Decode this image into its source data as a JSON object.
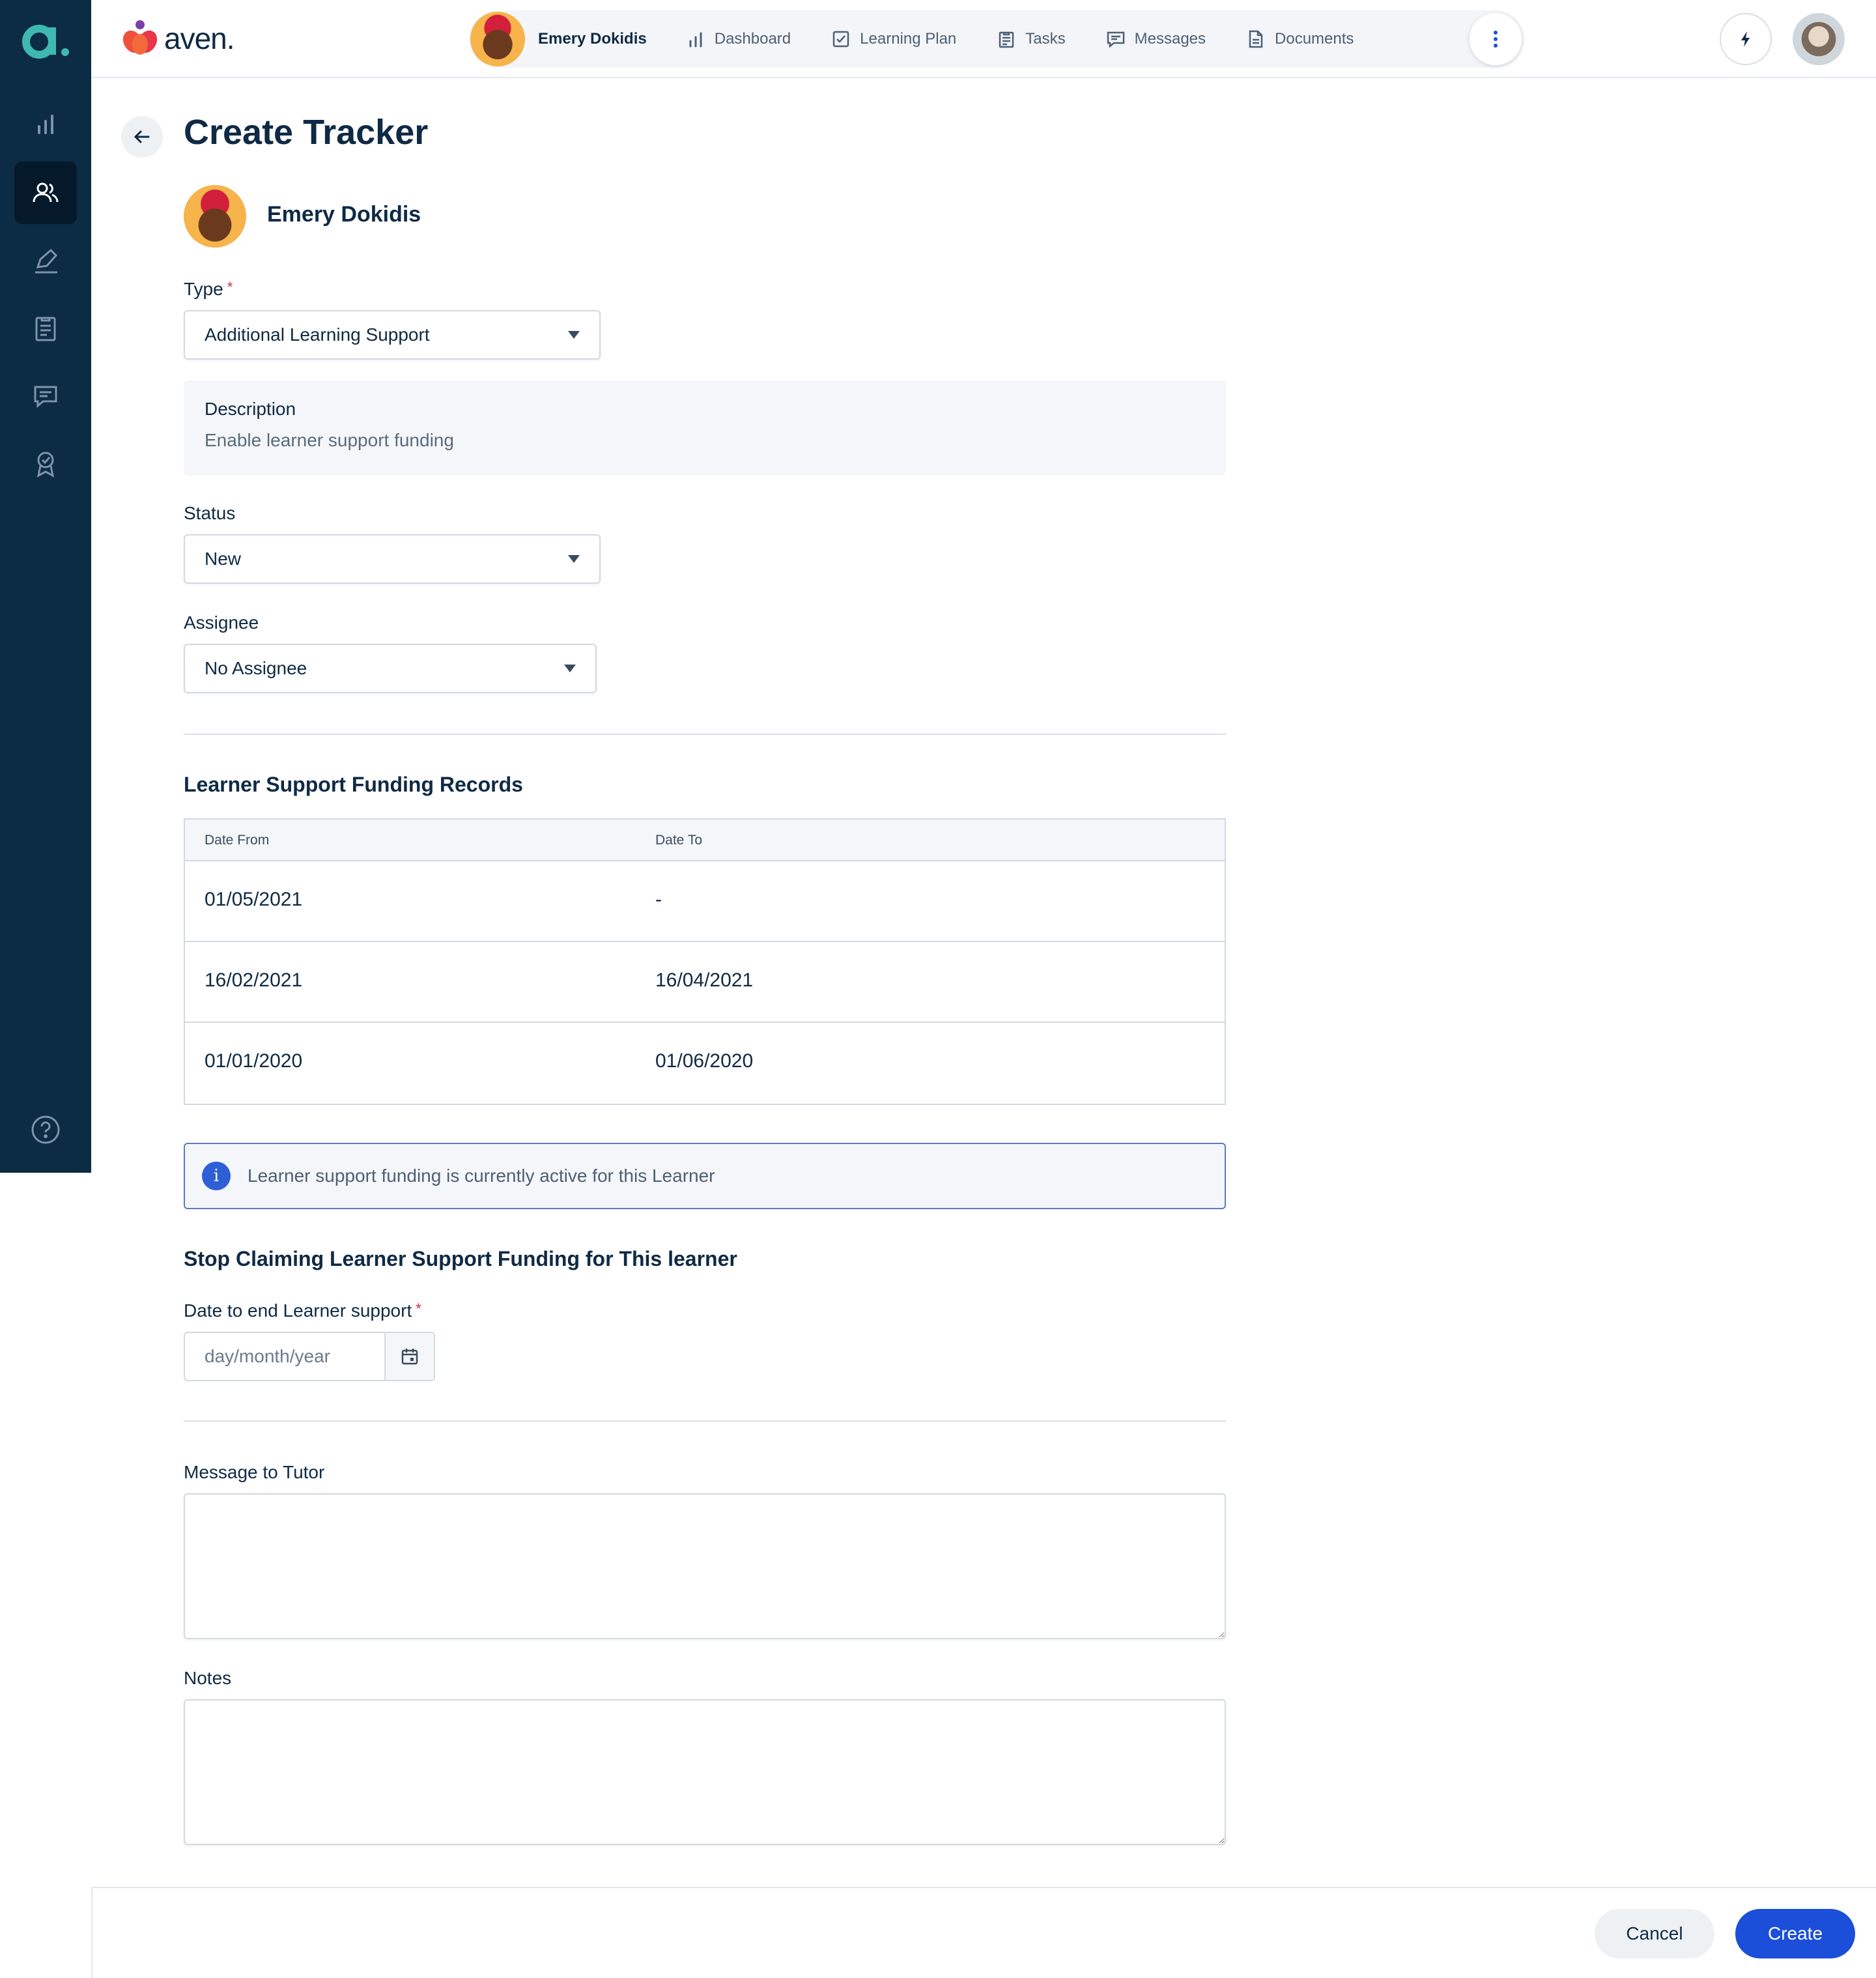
{
  "app": {
    "brand": "aven.",
    "rail_logo": "a."
  },
  "nav": {
    "learner_name": "Emery Dokidis",
    "links": [
      {
        "label": "Dashboard",
        "icon": "bar-chart-icon"
      },
      {
        "label": "Learning Plan",
        "icon": "checkbox-icon"
      },
      {
        "label": "Tasks",
        "icon": "clipboard-icon"
      },
      {
        "label": "Messages",
        "icon": "message-icon"
      },
      {
        "label": "Documents",
        "icon": "document-icon"
      }
    ]
  },
  "page": {
    "title": "Create Tracker",
    "learner_name": "Emery Dokidis"
  },
  "form": {
    "type_label": "Type",
    "type_value": "Additional Learning Support",
    "description_title": "Description",
    "description_text": "Enable learner support funding",
    "status_label": "Status",
    "status_value": "New",
    "assignee_label": "Assignee",
    "assignee_value": "No Assignee",
    "records_title": "Learner Support Funding Records",
    "table": {
      "headers": [
        "Date From",
        "Date To"
      ],
      "rows": [
        [
          "01/05/2021",
          "-"
        ],
        [
          "16/02/2021",
          "16/04/2021"
        ],
        [
          "01/01/2020",
          "01/06/2020"
        ]
      ]
    },
    "alert_text": "Learner support funding is currently active for this Learner",
    "stop_title": "Stop Claiming Learner Support Funding for This learner",
    "end_date_label": "Date to end Learner support",
    "end_date_placeholder": "day/month/year",
    "message_label": "Message to Tutor",
    "notes_label": "Notes",
    "required_mark": "*"
  },
  "footer": {
    "cancel_label": "Cancel",
    "create_label": "Create"
  },
  "colors": {
    "rail": "#0c2b45",
    "primary": "#1b4fd9",
    "required": "#d5273a",
    "brand_teal": "#3fb8b0"
  }
}
